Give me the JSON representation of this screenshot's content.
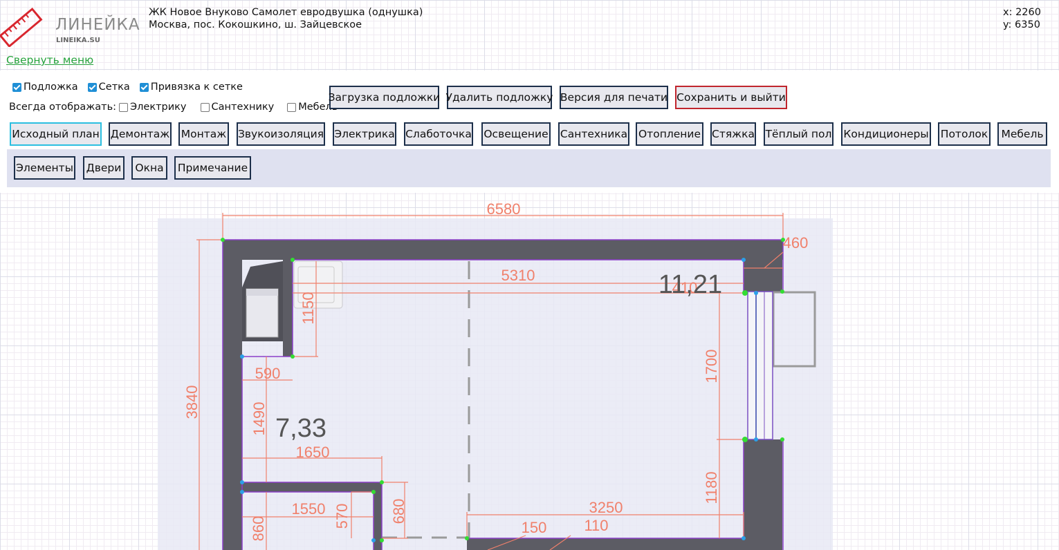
{
  "brand": {
    "name": "ЛИНЕЙКА",
    "site": "LINEIKA.SU"
  },
  "project": {
    "title": "ЖК Новое Внуково Самолет евродвушка (однушка)",
    "address": "Москва, пос. Кокошкино, ш. Зайцевское"
  },
  "cursor": {
    "x": "x: 2260",
    "y": "y: 6350"
  },
  "collapse_menu": "Свернуть меню",
  "options": {
    "underlay": {
      "label": "Подложка",
      "checked": true
    },
    "grid": {
      "label": "Сетка",
      "checked": true
    },
    "snap": {
      "label": "Привязка к сетке",
      "checked": true
    },
    "always_show_label": "Всегда отображать:",
    "electric": {
      "label": "Электрику",
      "checked": false
    },
    "plumbing": {
      "label": "Сантехнику",
      "checked": false
    },
    "furniture": {
      "label": "Мебель",
      "checked": false
    }
  },
  "actions": {
    "load_underlay": "Загрузка подложки",
    "delete_underlay": "Удалить подложку",
    "print_version": "Версия для печати",
    "save_exit": "Сохранить и выйти"
  },
  "tabs": [
    "Исходный план",
    "Демонтаж",
    "Монтаж",
    "Звукоизоляция",
    "Электрика",
    "Слаботочка",
    "Освещение",
    "Сантехника",
    "Отопление",
    "Стяжка",
    "Тёплый пол",
    "Кондиционеры",
    "Потолок",
    "Мебель"
  ],
  "active_tab": "Исходный план",
  "subtabs": [
    "Элементы",
    "Двери",
    "Окна",
    "Примечание"
  ],
  "plan": {
    "dimensions": {
      "d6580": "6580",
      "d460": "460",
      "d5310": "5310",
      "d410": "410",
      "d1150": "1150",
      "d590": "590",
      "d3840": "3840",
      "d1490": "1490",
      "d1700": "1700",
      "d1650": "1650",
      "d1180": "1180",
      "d1550": "1550",
      "d570": "570",
      "d680": "680",
      "d860": "860",
      "d3250": "3250",
      "d150": "150",
      "d110": "110"
    },
    "areas": {
      "kitchen": "11,21",
      "room": "7,33"
    }
  },
  "colors": {
    "wall": "#5c5c64",
    "dimension": "#f0806b",
    "outline": "#8b3ec8",
    "accent_link": "#27a33d",
    "button_border": "#1c2f4a",
    "save_border": "#c0252d",
    "active_border": "#2bbfe0"
  }
}
